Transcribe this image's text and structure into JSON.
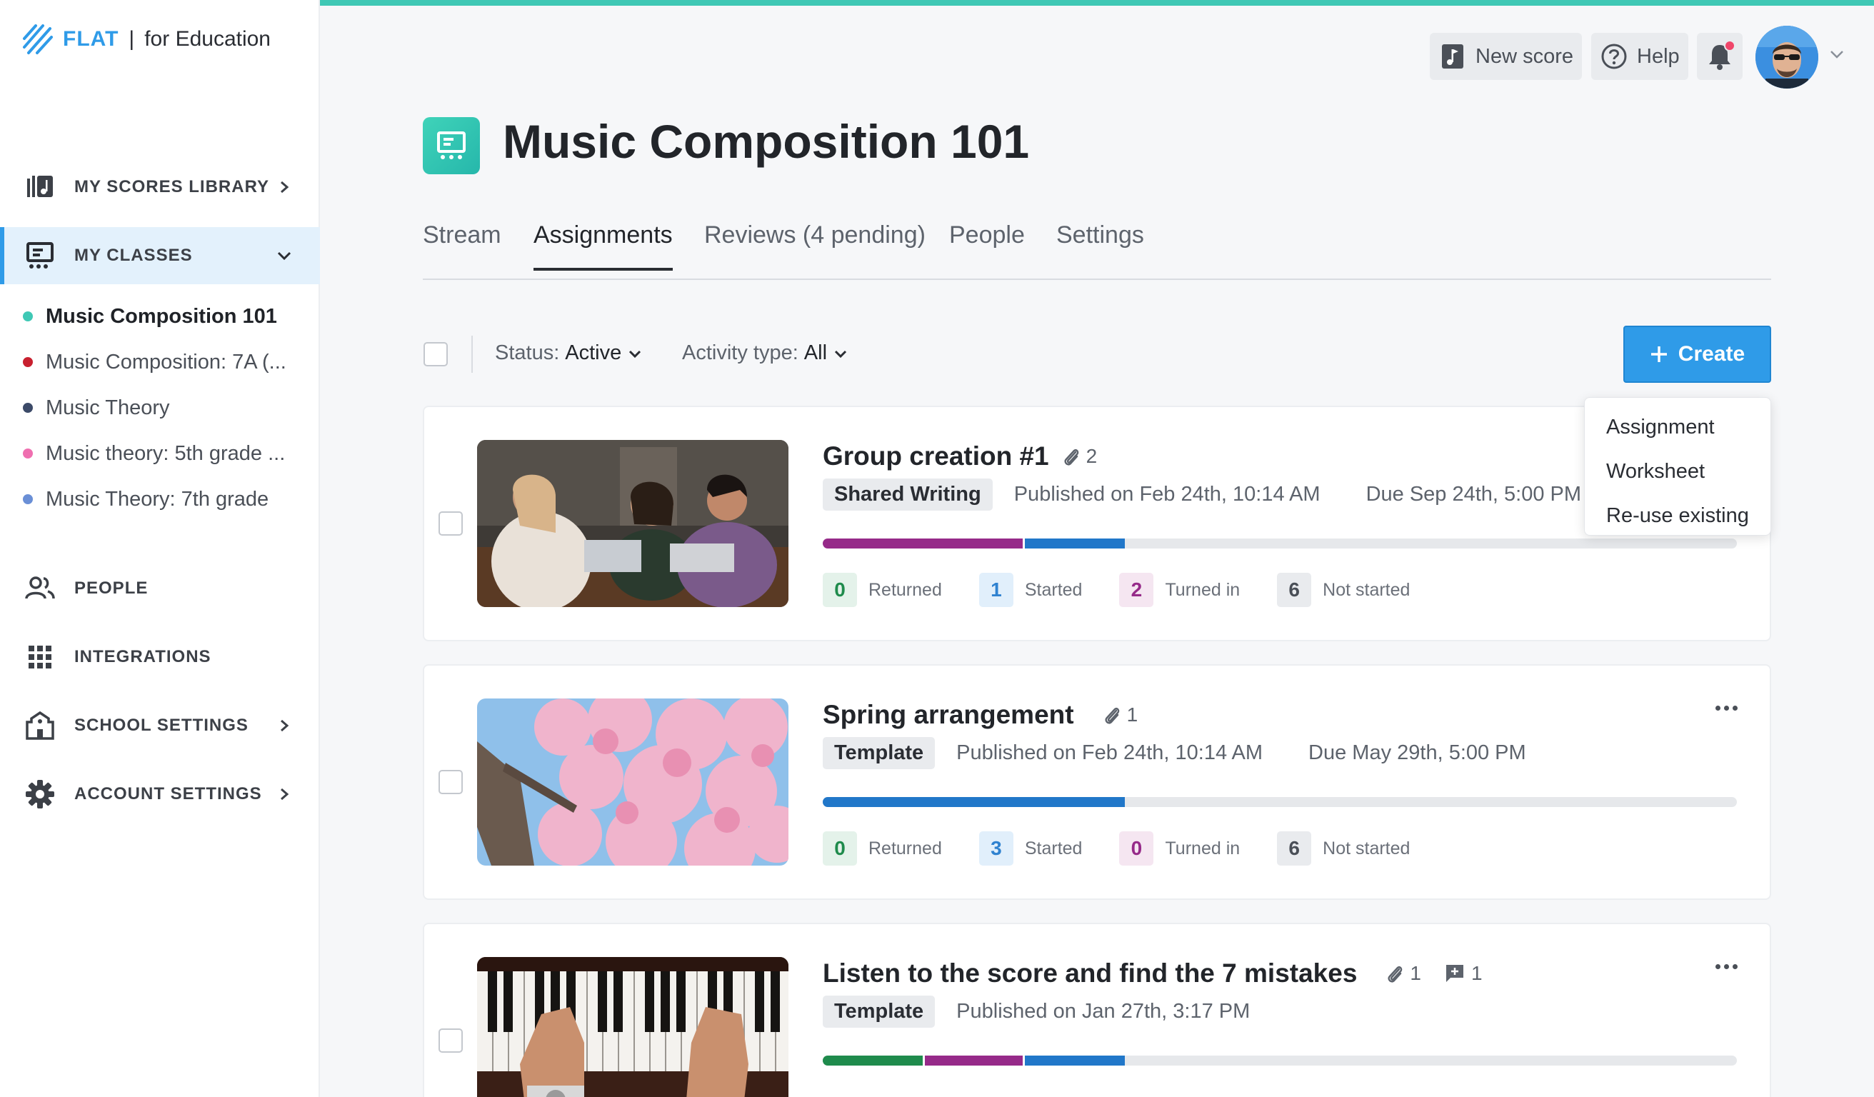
{
  "brand": {
    "name": "FLAT",
    "separator": "|",
    "suffix": "for Education"
  },
  "sidebar": {
    "nav": [
      {
        "label": "MY SCORES LIBRARY",
        "icon": "library-icon"
      },
      {
        "label": "MY CLASSES",
        "icon": "classes-icon"
      },
      {
        "label": "PEOPLE",
        "icon": "people-icon"
      },
      {
        "label": "INTEGRATIONS",
        "icon": "grid-icon"
      },
      {
        "label": "SCHOOL SETTINGS",
        "icon": "school-icon"
      },
      {
        "label": "ACCOUNT SETTINGS",
        "icon": "gear-icon"
      }
    ],
    "classes": [
      {
        "label": "Music Composition 101",
        "color": "#3fc8b5"
      },
      {
        "label": "Music Composition: 7A  (...",
        "color": "#c8202f"
      },
      {
        "label": "Music Theory",
        "color": "#3c4a68"
      },
      {
        "label": "Music theory: 5th grade  ...",
        "color": "#ef6fb0"
      },
      {
        "label": "Music Theory: 7th grade",
        "color": "#6a8fd6"
      }
    ]
  },
  "topbar": {
    "new_score": "New score",
    "help": "Help",
    "accent": "#3fc8b5"
  },
  "header": {
    "title": "Music Composition 101",
    "tabs": [
      "Stream",
      "Assignments",
      "Reviews (4 pending)",
      "People",
      "Settings"
    ],
    "active_tab": "Assignments"
  },
  "filters": {
    "status_label": "Status:",
    "status_value": "Active",
    "activity_label": "Activity type:",
    "activity_value": "All",
    "create": "Create"
  },
  "create_menu": [
    "Assignment",
    "Worksheet",
    "Re-use existing"
  ],
  "stat_labels": {
    "returned": "Returned",
    "started": "Started",
    "turned_in": "Turned in",
    "not_started": "Not started"
  },
  "assignments": [
    {
      "title": "Group creation #1",
      "attachments": "2",
      "type": "Shared Writing",
      "published": "Published on Feb 24th, 10:14 AM",
      "due": "Due Sep 24th, 5:00 PM",
      "returned": "0",
      "started": "1",
      "turned_in": "2",
      "not_started": "6"
    },
    {
      "title": "Spring arrangement",
      "attachments": "1",
      "type": "Template",
      "published": "Published on Feb 24th, 10:14 AM",
      "due": "Due May 29th, 5:00 PM",
      "returned": "0",
      "started": "3",
      "turned_in": "0",
      "not_started": "6"
    },
    {
      "title": "Listen to the score and find the 7 mistakes",
      "attachments": "1",
      "comments": "1",
      "type": "Template",
      "published": "Published on Jan 27th, 3:17 PM"
    }
  ],
  "colors": {
    "returned": "#1f8b4c",
    "started": "#2177c9",
    "turned_in": "#962a89",
    "primary": "#2f9be8"
  }
}
